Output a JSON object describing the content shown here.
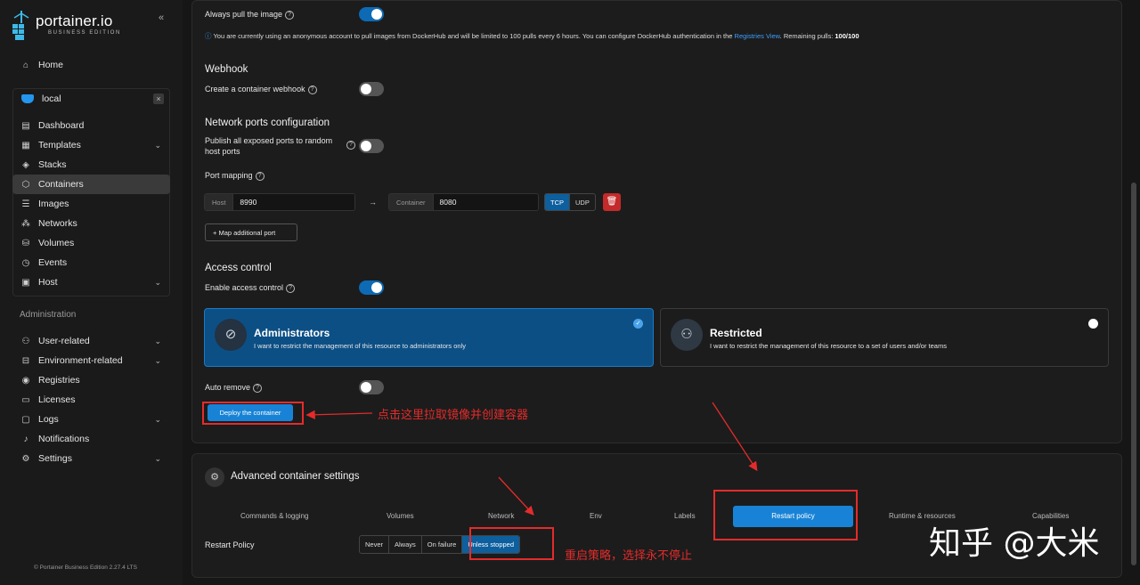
{
  "app": {
    "logo_title": "portainer.io",
    "logo_subtitle": "BUSINESS EDITION",
    "collapse_icon": "«"
  },
  "sidebar": {
    "home": "Home",
    "environment": {
      "name": "local",
      "close": "×"
    },
    "env_items": [
      {
        "label": "Dashboard",
        "icon": "dashboard-icon"
      },
      {
        "label": "Templates",
        "icon": "templates-icon",
        "expandable": true
      },
      {
        "label": "Stacks",
        "icon": "stacks-icon"
      },
      {
        "label": "Containers",
        "icon": "containers-icon",
        "active": true
      },
      {
        "label": "Images",
        "icon": "images-icon"
      },
      {
        "label": "Networks",
        "icon": "networks-icon"
      },
      {
        "label": "Volumes",
        "icon": "volumes-icon"
      },
      {
        "label": "Events",
        "icon": "events-icon"
      },
      {
        "label": "Host",
        "icon": "host-icon",
        "expandable": true
      }
    ],
    "admin_section": "Administration",
    "admin_items": [
      {
        "label": "User-related",
        "icon": "users-icon",
        "expandable": true
      },
      {
        "label": "Environment-related",
        "icon": "environment-icon",
        "expandable": true
      },
      {
        "label": "Registries",
        "icon": "registries-icon"
      },
      {
        "label": "Licenses",
        "icon": "licenses-icon"
      },
      {
        "label": "Logs",
        "icon": "logs-icon",
        "expandable": true
      },
      {
        "label": "Notifications",
        "icon": "bell-icon"
      },
      {
        "label": "Settings",
        "icon": "settings-icon",
        "expandable": true
      }
    ],
    "footer": "© Portainer Business Edition 2.27.4 LTS"
  },
  "form": {
    "always_pull_label": "Always pull the image",
    "always_pull_on": true,
    "info_prefix": "You are currently using an anonymous account to pull images from DockerHub and will be limited to 100 pulls every 6 hours. You can configure DockerHub authentication in the",
    "info_link": "Registries View",
    "info_remaining_label": ". Remaining pulls:",
    "info_remaining_value": "100/100",
    "webhook_title": "Webhook",
    "webhook_label": "Create a container webhook",
    "webhook_on": false,
    "network_title": "Network ports configuration",
    "publish_label_1": "Publish all exposed ports to random",
    "publish_label_2": "host ports",
    "publish_on": false,
    "port_mapping_label": "Port mapping",
    "host_addon": "Host",
    "host_value": "8990",
    "arrow": "→",
    "container_addon": "Container",
    "container_value": "8080",
    "protocols": [
      "TCP",
      "UDP"
    ],
    "selected_protocol": "TCP",
    "map_port_button": "+ Map additional port",
    "access_title": "Access control",
    "access_label": "Enable access control",
    "access_on": true,
    "cards": [
      {
        "title": "Administrators",
        "desc": "I want to restrict the management of this resource to administrators only",
        "icon": "eye-off-icon",
        "selected": true
      },
      {
        "title": "Restricted",
        "desc": "I want to restrict the management of this resource to a set of users and/or teams",
        "icon": "users-icon",
        "selected": false
      }
    ],
    "auto_remove_label": "Auto remove",
    "auto_remove_on": false,
    "deploy_button": "Deploy the container"
  },
  "annotations": {
    "deploy_note": "点击这里拉取镜像并创建容器",
    "restart_note": "重启策略，选择永不停止"
  },
  "advanced": {
    "title": "Advanced container settings",
    "tabs": [
      "Commands & logging",
      "Volumes",
      "Network",
      "Env",
      "Labels",
      "Restart policy",
      "Runtime & resources",
      "Capabilities"
    ],
    "active_tab": "Restart policy",
    "restart_label": "Restart Policy",
    "restart_options": [
      "Never",
      "Always",
      "On failure",
      "Unless stopped"
    ],
    "restart_selected": "Unless stopped"
  },
  "watermark": "知乎 @大米"
}
